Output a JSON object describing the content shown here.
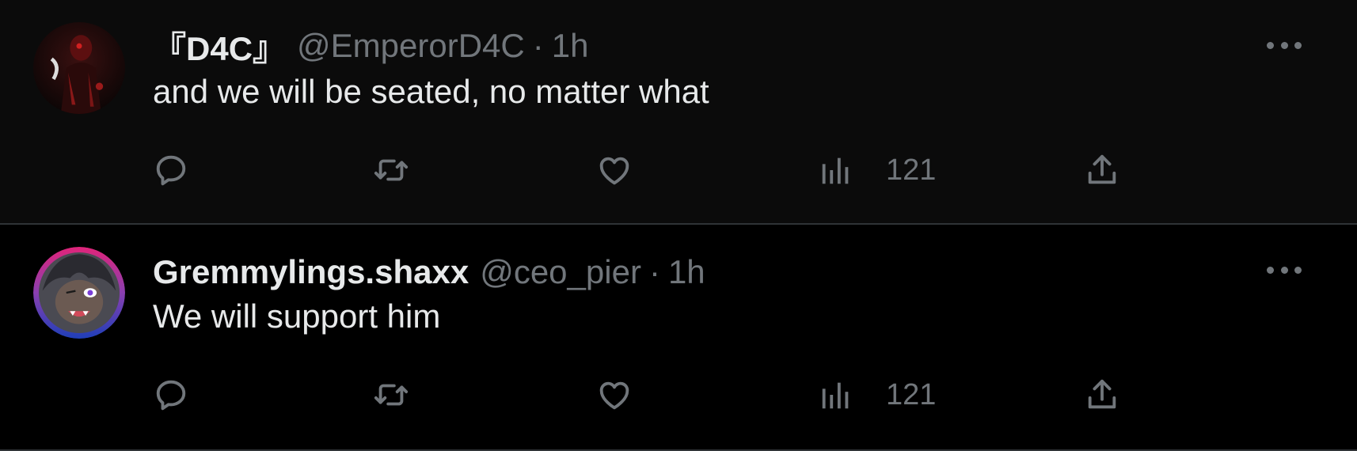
{
  "tweets": [
    {
      "display_name": "『D4C』",
      "handle": "@EmperorD4C",
      "separator": "·",
      "time": "1h",
      "text": "and we will be seated, no matter what",
      "views": "121",
      "avatar_icon": "dark-red-figure-avatar"
    },
    {
      "display_name": "Gremmylings.shaxx",
      "handle": "@ceo_pier",
      "separator": "·",
      "time": "1h",
      "text": "We will support him",
      "views": "121",
      "avatar_icon": "anime-character-avatar"
    }
  ],
  "icons": {
    "reply": "reply-icon",
    "retweet": "retweet-icon",
    "like": "heart-icon",
    "views": "views-chart-icon",
    "share": "share-icon",
    "more": "more-dots-icon"
  },
  "colors": {
    "background": "#000000",
    "background_alt": "#0b0b0b",
    "text_primary": "#e7e9ea",
    "text_secondary": "#71767b",
    "divider": "#2f3336"
  }
}
